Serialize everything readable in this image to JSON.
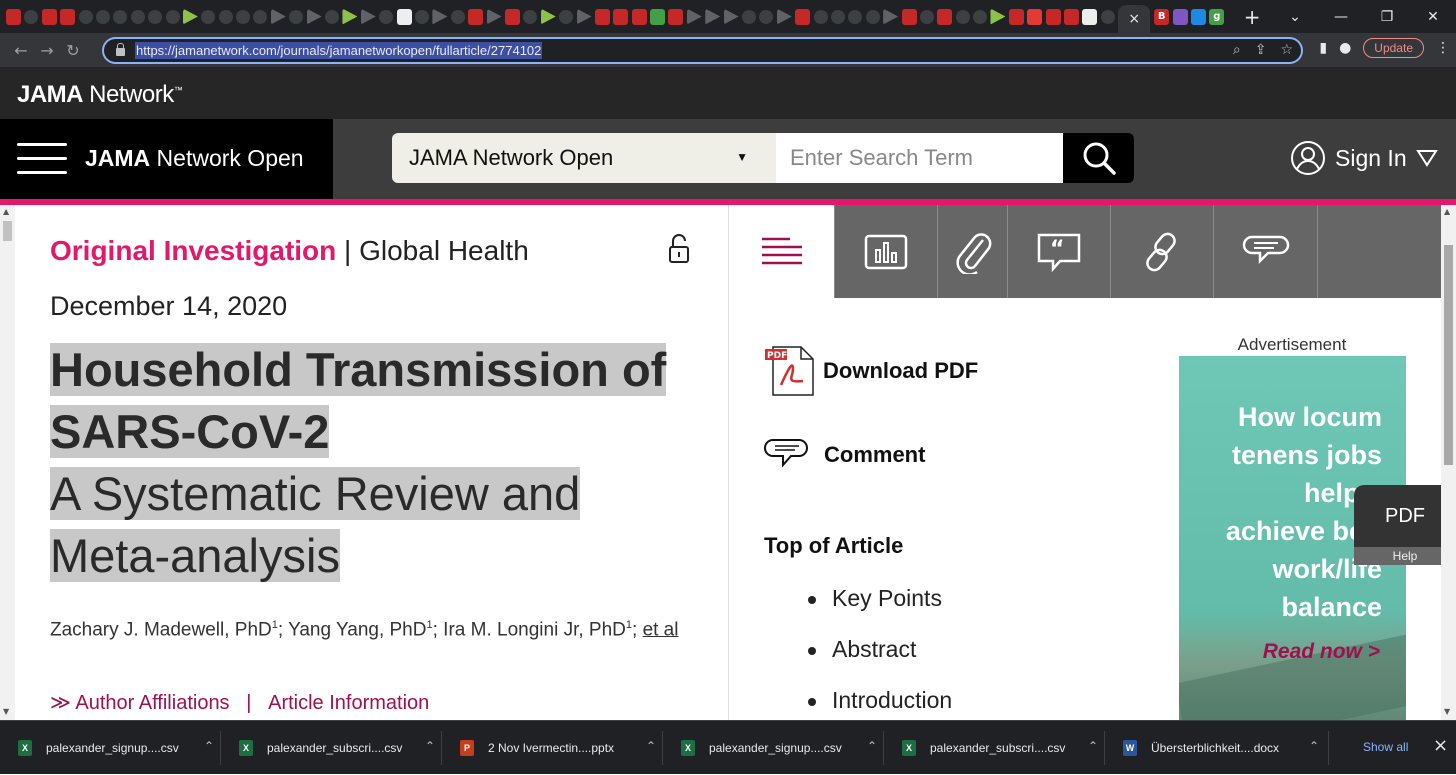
{
  "browser": {
    "url": "https://jamanetwork.com/journals/jamanetworkopen/fullarticle/2774102",
    "update_label": "Update",
    "new_tab_symbol": "+",
    "active_tab_close": "×"
  },
  "site": {
    "logo_bold": "JAMA",
    "logo_rest": " Network",
    "logo_tm": "™",
    "journal_bold": "JAMA",
    "journal_rest": " Network Open",
    "search_scope": "JAMA Network Open",
    "search_placeholder": "Enter Search Term",
    "sign_in": "Sign In",
    "accent_color": "#e5176b"
  },
  "article": {
    "kicker_type": "Original Investigation",
    "kicker_sep": " | ",
    "kicker_topic": "Global Health",
    "date": "December 14, 2020",
    "title_line1": "Household Transmission of",
    "title_line2": "SARS-CoV-2",
    "subtitle_line1": "A Systematic Review and",
    "subtitle_line2": "Meta-analysis",
    "author1": "Zachary J. Madewell, PhD",
    "author2": "Yang Yang, PhD",
    "author3": "Ira M. Longini Jr, PhD",
    "aff_num": "1",
    "sep": "; ",
    "etal": "et al",
    "affil_arrow": "≫",
    "affiliations": "Author Affiliations",
    "affil_sep": "|",
    "article_info": "Article Information"
  },
  "sidebar": {
    "download_pdf": "Download PDF",
    "pdf_badge": "PDF",
    "comment": "Comment",
    "toa_title": "Top of Article",
    "toa_items": [
      "Key Points",
      "Abstract",
      "Introduction"
    ],
    "ad_label": "Advertisement",
    "ad_text_1": "How locum",
    "ad_text_2": "tenens jobs",
    "ad_text_3": "help y",
    "ad_text_4": "achieve bett",
    "ad_text_5": "work/life",
    "ad_text_6": "balance",
    "ad_cta": "Read now >",
    "pdf_float": "PDF",
    "help_float": "Help"
  },
  "downloads": {
    "items": [
      {
        "name": "palexander_signup....csv",
        "type": "xlsx",
        "icon_letter": "X"
      },
      {
        "name": "palexander_subscri....csv",
        "type": "xlsx",
        "icon_letter": "X"
      },
      {
        "name": "2 Nov Ivermectin....pptx",
        "type": "pptx",
        "icon_letter": "P"
      },
      {
        "name": "palexander_signup....csv",
        "type": "xlsx",
        "icon_letter": "X"
      },
      {
        "name": "palexander_subscri....csv",
        "type": "xlsx",
        "icon_letter": "X"
      },
      {
        "name": "Übersterblichkeit....docx",
        "type": "docx",
        "icon_letter": "W"
      }
    ],
    "show_all": "Show all",
    "close": "×"
  }
}
